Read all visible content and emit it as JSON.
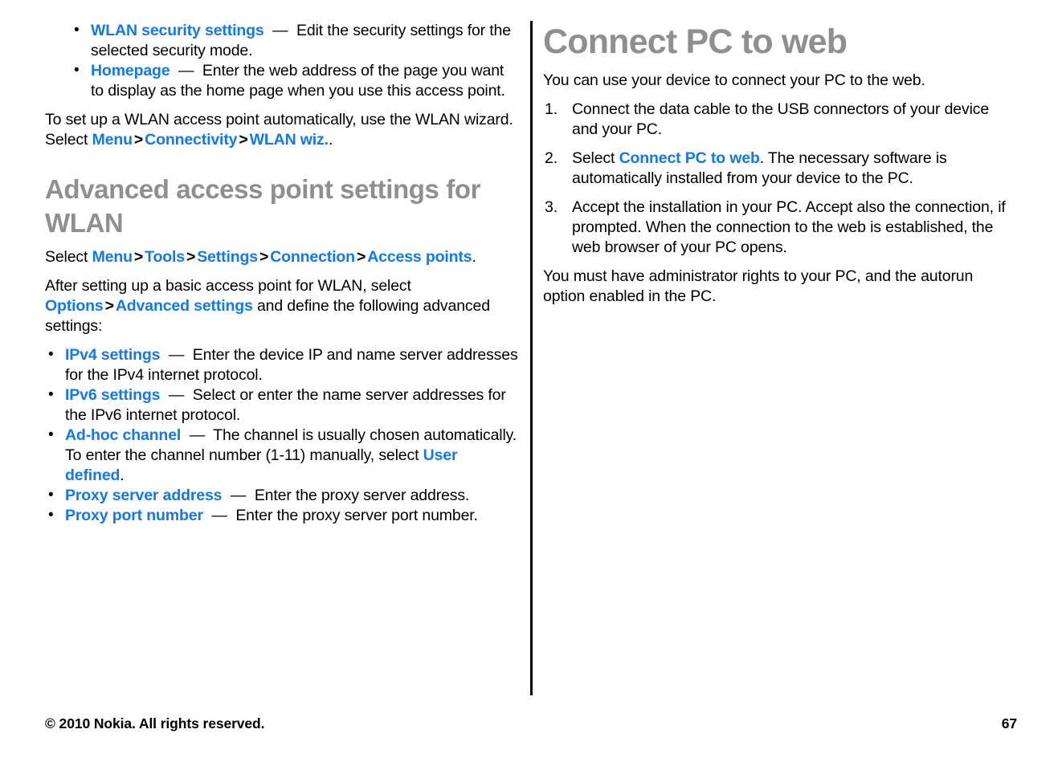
{
  "page": {
    "number": "67",
    "copyright": "© 2010 Nokia. All rights reserved."
  },
  "left_column": {
    "top_bullets": [
      {
        "link": "WLAN security settings",
        "dash": "  —  ",
        "text": "Edit the security settings for the selected security mode."
      },
      {
        "link": "Homepage",
        "dash": "  —  ",
        "text": "Enter the web address of the page you want to display as the home page when you use this access point."
      }
    ],
    "wizard_para": {
      "lead": "To set up a WLAN access point automatically, use the WLAN wizard. Select ",
      "link1": "Menu",
      "sep1": ">",
      "link2": "Connectivity",
      "sep2": ">",
      "link3": "WLAN wiz.",
      "tail": "."
    },
    "heading": "Advanced access point settings for WLAN",
    "select_para": {
      "lead": "Select ",
      "link1": "Menu",
      "sep1": ">",
      "link2": "Tools",
      "sep2": ">",
      "link3": "Settings",
      "sep3": ">",
      "link4": "Connection",
      "sep4": ">",
      "link5": "Access points",
      "tail": "."
    },
    "after_para": {
      "lead": "After setting up a basic access point for WLAN, select ",
      "link1": "Options",
      "sep1": ">",
      "link2": "Advanced settings",
      "tail": " and define the following advanced settings:"
    },
    "advanced_bullets": [
      {
        "link": "IPv4 settings",
        "dash": "  —  ",
        "text": "Enter the device IP and name server addresses for the IPv4 internet protocol."
      },
      {
        "link": "IPv6 settings",
        "dash": "  —  ",
        "text": "Select or enter the name server addresses for the IPv6 internet protocol."
      },
      {
        "link": "Ad-hoc channel",
        "dash": "  —  ",
        "text": "The channel is usually chosen automatically. To enter the channel number (1-11) manually, select ",
        "link2": "User defined",
        "tail": "."
      },
      {
        "link": "Proxy server address",
        "dash": "  —  ",
        "text": "Enter the proxy server address."
      },
      {
        "link": "Proxy port number",
        "dash": "  —  ",
        "text": "Enter the proxy server port number."
      }
    ]
  },
  "right_column": {
    "heading": "Connect PC to web",
    "intro": "You can use your device to connect your PC to the web.",
    "steps": [
      {
        "text": "Connect the data cable to the USB connectors of your device and your PC."
      },
      {
        "lead": "Select ",
        "link": "Connect PC to web",
        "tail": ". The necessary software is automatically installed from your device to the PC."
      },
      {
        "text": "Accept the installation in your PC. Accept also the connection, if prompted. When the connection to the web is established, the web browser of your PC opens."
      }
    ],
    "outro": "You must have administrator rights to your PC, and the autorun option enabled in the PC."
  },
  "colors": {
    "link_blue": "#1478e8",
    "heading_gray": "#8f8f8f",
    "body_black": "#000000"
  }
}
